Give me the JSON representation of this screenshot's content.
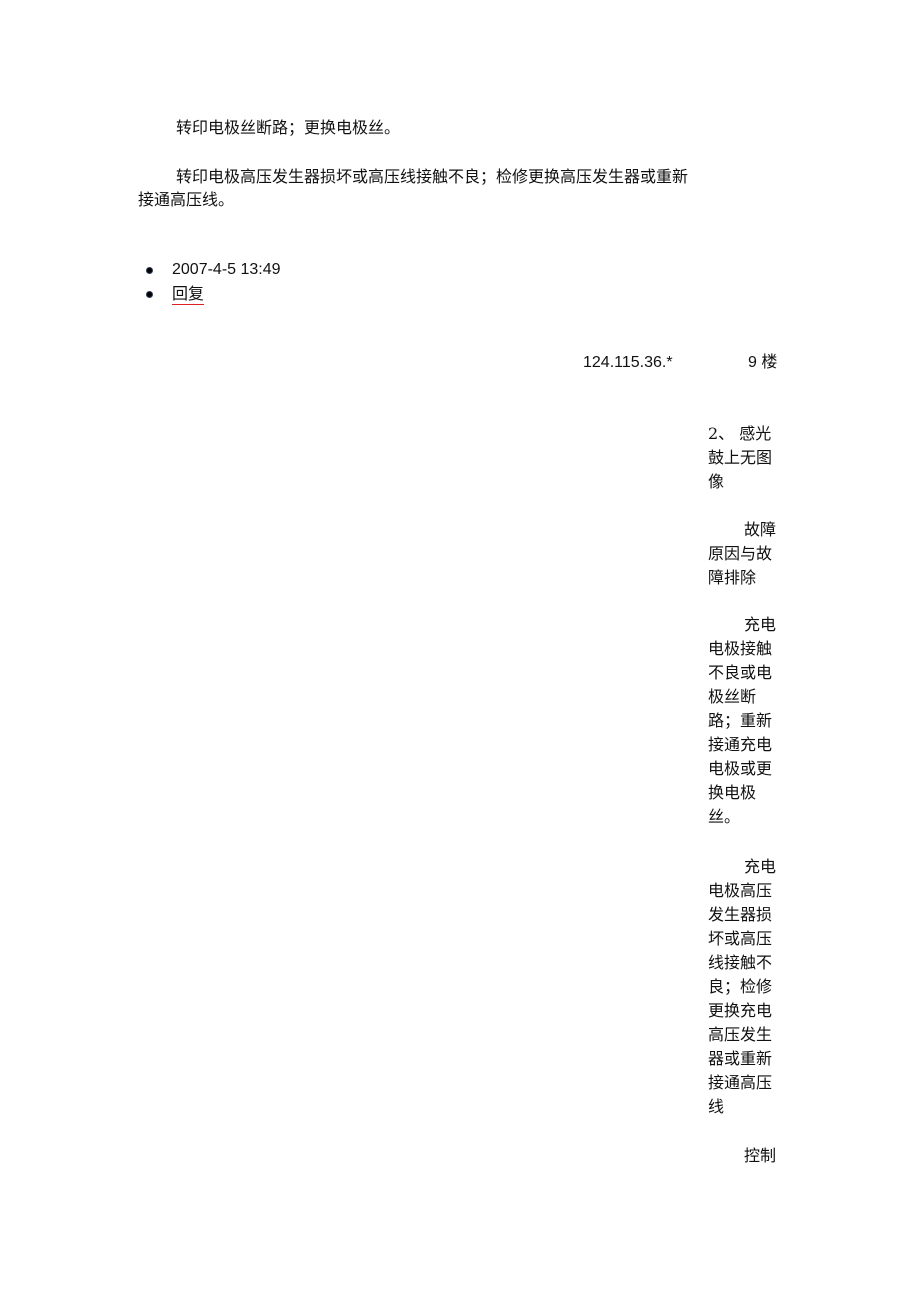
{
  "document": {
    "paragraph1": "转印电极丝断路；更换电极丝。",
    "paragraph2_line1": "转印电极高压发生器损坏或高压线接触不良；检修更换高压发生器或重新",
    "paragraph2_line2": "接通高压线。"
  },
  "post_meta": {
    "timestamp": "2007-4-5  13:49",
    "reply_label": "回复"
  },
  "reply_header": {
    "ip": "124.115.36.*",
    "floor": "9 楼"
  },
  "reply_content": {
    "heading": "2、 感光鼓上无图像",
    "section_label": "故障原因与故障排除",
    "item1": "充电电极接触不良或电极丝断路；重新接通充电电极或更换电极丝。",
    "item2": "充电电极高压发生器损坏或高压线接触不良；检修更换充电高压发生器或重新接通高压线",
    "item3": "控制"
  }
}
